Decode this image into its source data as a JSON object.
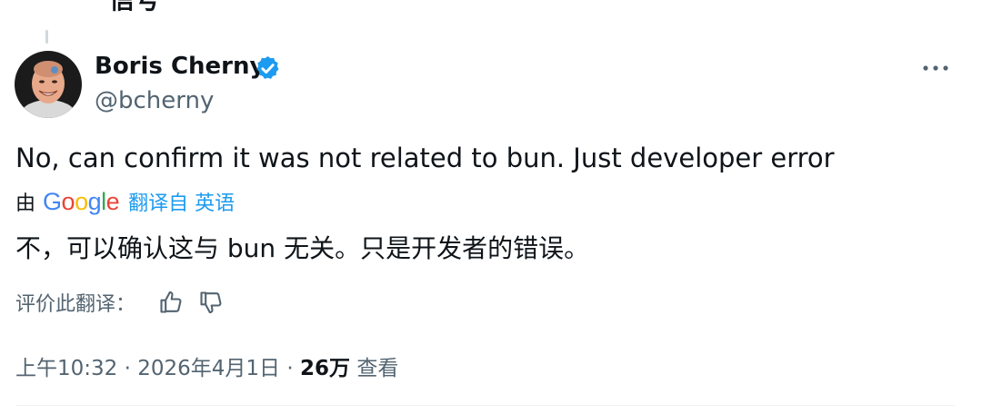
{
  "previous_tweet": {
    "partial_text": "信号"
  },
  "author": {
    "display_name": "Boris Cherny",
    "handle": "@bcherny",
    "verified_icon": "verified-badge-icon",
    "avatar_icon": "avatar-photo"
  },
  "more_icon": "more-dots-icon",
  "tweet": {
    "text": "No, can confirm it was not related to bun. Just developer error"
  },
  "translation": {
    "by_label": "由",
    "google_logo": "Google",
    "link_label": "翻译自 英语",
    "translated_text": "不，可以确认这与 bun 无关。只是开发者的错误。",
    "rate_label": "评价此翻译：",
    "thumb_up_icon": "thumb-up-icon",
    "thumb_down_icon": "thumb-down-icon"
  },
  "meta": {
    "time": "上午10:32",
    "separator": "·",
    "date": "2026年4月1日",
    "views_count": "26万",
    "views_label": "查看"
  },
  "colors": {
    "text": "#0f1419",
    "secondary": "#536471",
    "link": "#1d9bf0",
    "verified": "#1d9bf0"
  }
}
